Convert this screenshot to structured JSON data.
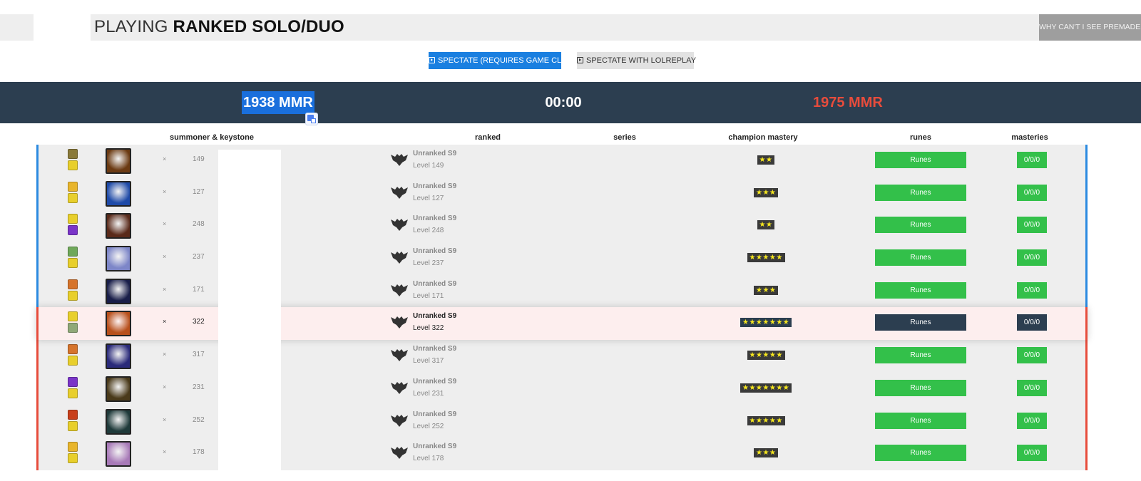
{
  "title": {
    "prefix": "PLAYING ",
    "queue": "RANKED SOLO/DUO"
  },
  "premades_button": "WHY CAN'T I SEE PREMADES?",
  "spectate": {
    "primary": "SPECTATE (REQUIRES GAME CLIENT)",
    "secondary": "SPECTATE WITH LOLREPLAY"
  },
  "score": {
    "blue_mmr": "1938 MMR",
    "timer": "00:00",
    "red_mmr": "1975 MMR"
  },
  "colors": {
    "blue_team": "#2b8ae0",
    "red_team": "#e74c3c",
    "score_bar": "#2c3e50",
    "runes_green": "#33c04a",
    "mastery_star": "#f6e71f"
  },
  "headers": {
    "summoner": "summoner & keystone",
    "ranked": "ranked",
    "series": "series",
    "champion_mastery": "champion mastery",
    "runes": "runes",
    "masteries": "masteries"
  },
  "players": [
    {
      "team": "blue",
      "remove": "×",
      "level": "149",
      "rank": "Unranked S9",
      "level_text": "Level 149",
      "mastery": "★★",
      "runes": "Runes",
      "masteries": "0/0/0",
      "spell1": "#8a7a3a",
      "spell2": "#e8cf2c",
      "champ": "#6b3a12"
    },
    {
      "team": "blue",
      "remove": "×",
      "level": "127",
      "rank": "Unranked S9",
      "level_text": "Level 127",
      "mastery": "★★★",
      "runes": "Runes",
      "masteries": "0/0/0",
      "spell1": "#e8b52c",
      "spell2": "#e8cf2c",
      "champ": "#1e4aa8"
    },
    {
      "team": "blue",
      "remove": "×",
      "level": "248",
      "rank": "Unranked S9",
      "level_text": "Level 248",
      "mastery": "★★",
      "runes": "Runes",
      "masteries": "0/0/0",
      "spell1": "#e8cf2c",
      "spell2": "#7a35c8",
      "champ": "#5a2a1a"
    },
    {
      "team": "blue",
      "remove": "×",
      "level": "237",
      "rank": "Unranked S9",
      "level_text": "Level 237",
      "mastery": "★★★★★",
      "runes": "Runes",
      "masteries": "0/0/0",
      "spell1": "#6fa85a",
      "spell2": "#e8cf2c",
      "champ": "#7d86c8"
    },
    {
      "team": "blue",
      "remove": "×",
      "level": "171",
      "rank": "Unranked S9",
      "level_text": "Level 171",
      "mastery": "★★★",
      "runes": "Runes",
      "masteries": "0/0/0",
      "spell1": "#d6742c",
      "spell2": "#e8cf2c",
      "champ": "#1a1f4a"
    },
    {
      "team": "red",
      "remove": "×",
      "level": "322",
      "rank": "Unranked S9",
      "level_text": "Level 322",
      "mastery": "★★★★★★★",
      "runes": "Runes",
      "masteries": "0/0/0",
      "spell1": "#e8cf2c",
      "spell2": "#8fa878",
      "champ": "#b8501c",
      "highlight": true
    },
    {
      "team": "red",
      "remove": "×",
      "level": "317",
      "rank": "Unranked S9",
      "level_text": "Level 317",
      "mastery": "★★★★★",
      "runes": "Runes",
      "masteries": "0/0/0",
      "spell1": "#d6742c",
      "spell2": "#e8cf2c",
      "champ": "#2a2a7a"
    },
    {
      "team": "red",
      "remove": "×",
      "level": "231",
      "rank": "Unranked S9",
      "level_text": "Level 231",
      "mastery": "★★★★★★★",
      "runes": "Runes",
      "masteries": "0/0/0",
      "spell1": "#7a35c8",
      "spell2": "#e8cf2c",
      "champ": "#4a3a1a"
    },
    {
      "team": "red",
      "remove": "×",
      "level": "252",
      "rank": "Unranked S9",
      "level_text": "Level 252",
      "mastery": "★★★★★",
      "runes": "Runes",
      "masteries": "0/0/0",
      "spell1": "#c8401c",
      "spell2": "#e8cf2c",
      "champ": "#1f3a3a"
    },
    {
      "team": "red",
      "remove": "×",
      "level": "178",
      "rank": "Unranked S9",
      "level_text": "Level 178",
      "mastery": "★★★",
      "runes": "Runes",
      "masteries": "0/0/0",
      "spell1": "#e8b52c",
      "spell2": "#e8cf2c",
      "champ": "#a87ab8"
    }
  ]
}
